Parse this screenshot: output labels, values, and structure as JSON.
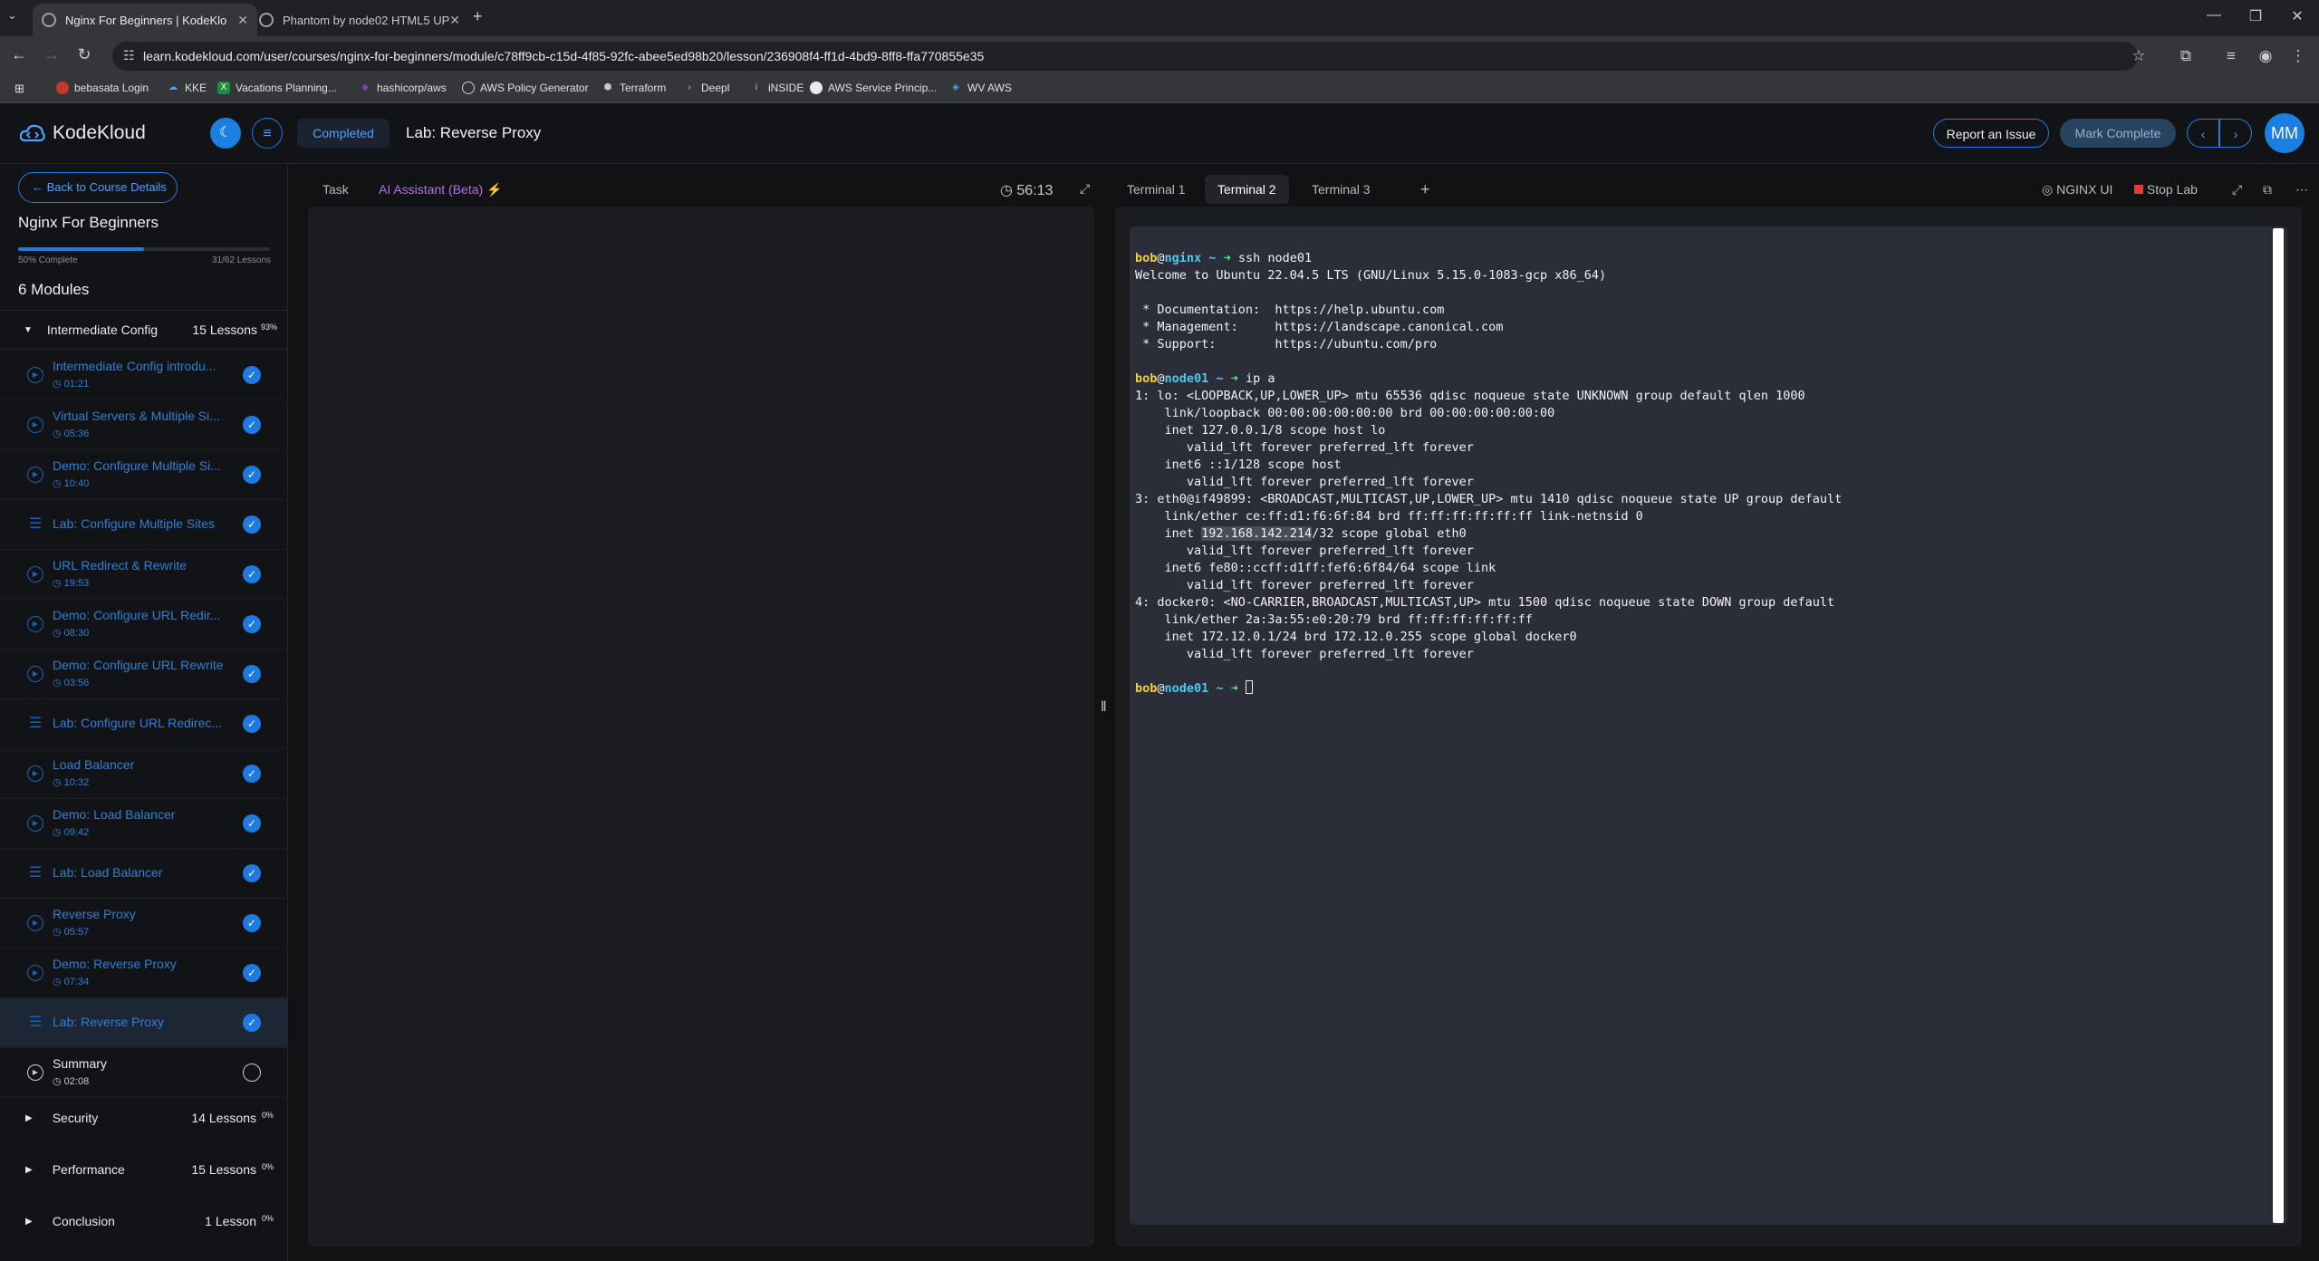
{
  "browser": {
    "tabs": [
      {
        "title": "Nginx For Beginners | KodeKlo"
      },
      {
        "title": "Phantom by node02 HTML5 UP"
      }
    ],
    "url": "learn.kodekloud.com/user/courses/nginx-for-beginners/module/c78ff9cb-c15d-4f85-92fc-abee5ed98b20/lesson/236908f4-ff1d-4bd9-8ff8-ffa770855e35",
    "bookmarks": [
      "bebasata Login",
      "KKE",
      "Vacations Planning...",
      "hashicorp/aws",
      "AWS Policy Generator",
      "Terraform",
      "Deepl",
      "iNSIDE",
      "AWS Service Princip...",
      "WV AWS"
    ]
  },
  "header": {
    "logo_text": "KodeKloud",
    "status_label": "Completed",
    "lesson_title": "Lab: Reverse Proxy",
    "report_label": "Report an Issue",
    "mark_complete_label": "Mark Complete",
    "avatar_initials": "MM"
  },
  "sidebar": {
    "back_label": "Back to Course Details",
    "course_title": "Nginx For Beginners",
    "progress_percent": 50,
    "progress_label": "50% Complete",
    "lessons_count_label": "31/62 Lessons",
    "modules_label": "6 Modules",
    "open_module": {
      "name": "Intermediate Config",
      "lessons": "15 Lessons",
      "percent": "93%"
    },
    "lessons": [
      {
        "title": "Intermediate Config introdu...",
        "duration": "01:21",
        "kind": "video",
        "done": true
      },
      {
        "title": "Virtual Servers & Multiple Si...",
        "duration": "05:36",
        "kind": "video",
        "done": true
      },
      {
        "title": "Demo: Configure Multiple Si...",
        "duration": "10:40",
        "kind": "video",
        "done": true
      },
      {
        "title": "Lab: Configure Multiple Sites",
        "duration": "",
        "kind": "lab",
        "done": true
      },
      {
        "title": "URL Redirect & Rewrite",
        "duration": "19:53",
        "kind": "video",
        "done": true
      },
      {
        "title": "Demo: Configure URL Redir...",
        "duration": "08:30",
        "kind": "video",
        "done": true
      },
      {
        "title": "Demo: Configure URL Rewrite",
        "duration": "03:56",
        "kind": "video",
        "done": true
      },
      {
        "title": "Lab: Configure URL Redirec...",
        "duration": "",
        "kind": "lab",
        "done": true
      },
      {
        "title": "Load Balancer",
        "duration": "10:32",
        "kind": "video",
        "done": true
      },
      {
        "title": "Demo: Load Balancer",
        "duration": "09:42",
        "kind": "video",
        "done": true
      },
      {
        "title": "Lab: Load Balancer",
        "duration": "",
        "kind": "lab",
        "done": true
      },
      {
        "title": "Reverse Proxy",
        "duration": "05:57",
        "kind": "video",
        "done": true
      },
      {
        "title": "Demo: Reverse Proxy",
        "duration": "07:34",
        "kind": "video",
        "done": true
      },
      {
        "title": "Lab: Reverse Proxy",
        "duration": "",
        "kind": "lab",
        "done": true,
        "active": true
      },
      {
        "title": "Summary",
        "duration": "02:08",
        "kind": "video",
        "done": false
      }
    ],
    "other_modules": [
      {
        "name": "Security",
        "lessons": "14 Lessons",
        "percent": "0%"
      },
      {
        "name": "Performance",
        "lessons": "15 Lessons",
        "percent": "0%"
      },
      {
        "name": "Conclusion",
        "lessons": "1 Lesson",
        "percent": "0%"
      }
    ]
  },
  "mid": {
    "tab_task": "Task",
    "tab_ai": "AI Assistant (Beta)",
    "timer": "56:13"
  },
  "terminal": {
    "tabs": [
      "Terminal 1",
      "Terminal 2",
      "Terminal 3"
    ],
    "active_tab": "Terminal 2",
    "nginx_ui_label": "NGINX UI",
    "stop_lab_label": "Stop Lab",
    "prompt_user": "bob",
    "prompt_host1": "nginx",
    "prompt_host2": "node01",
    "cmd1": "ssh node01",
    "cmd2": "ip a",
    "output1": "Welcome to Ubuntu 22.04.5 LTS (GNU/Linux 5.15.0-1083-gcp x86_64)\n\n * Documentation:  https://help.ubuntu.com\n * Management:     https://landscape.canonical.com\n * Support:        https://ubuntu.com/pro\n",
    "output2a": "1: lo: <LOOPBACK,UP,LOWER_UP> mtu 65536 qdisc noqueue state UNKNOWN group default qlen 1000\n    link/loopback 00:00:00:00:00:00 brd 00:00:00:00:00:00\n    inet 127.0.0.1/8 scope host lo\n       valid_lft forever preferred_lft forever\n    inet6 ::1/128 scope host\n       valid_lft forever preferred_lft forever\n3: eth0@if49899: <BROADCAST,MULTICAST,UP,LOWER_UP> mtu 1410 qdisc noqueue state UP group default\n    link/ether ce:ff:d1:f6:6f:84 brd ff:ff:ff:ff:ff:ff link-netnsid 0\n    inet ",
    "highlight_ip": "192.168.142.214",
    "output2b": "/32 scope global eth0\n       valid_lft forever preferred_lft forever\n    inet6 fe80::ccff:d1ff:fef6:6f84/64 scope link\n       valid_lft forever preferred_lft forever\n4: docker0: <NO-CARRIER,BROADCAST,MULTICAST,UP> mtu 1500 qdisc noqueue state DOWN group default\n    link/ether 2a:3a:55:e0:20:79 brd ff:ff:ff:ff:ff:ff\n    inet 172.12.0.1/24 brd 172.12.0.255 scope global docker0\n       valid_lft forever preferred_lft forever\n"
  },
  "colors": {
    "accent": "#1a7fe0",
    "prompt_user": "#f4d03f",
    "prompt_host": "#4ec9f0",
    "prompt_arrow": "#50fa7b",
    "terminal_bg": "#2b2d38"
  }
}
